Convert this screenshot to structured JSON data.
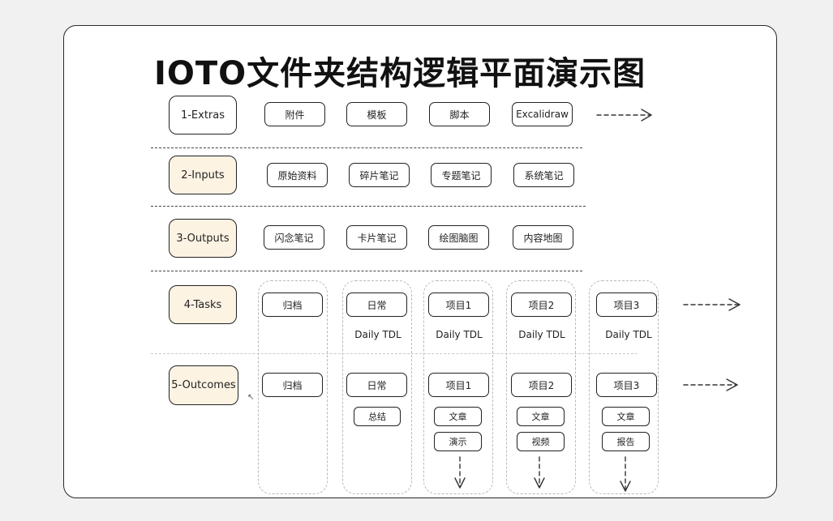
{
  "title": "IOTO文件夹结构逻辑平面演示图",
  "categories": [
    "1-Extras",
    "2-Inputs",
    "3-Outputs",
    "4-Tasks",
    "5-Outcomes"
  ],
  "extras": [
    "附件",
    "模板",
    "脚本",
    "Excalidraw"
  ],
  "inputs": [
    "原始资料",
    "碎片笔记",
    "专题笔记",
    "系统笔记"
  ],
  "outputs": [
    "闪念笔记",
    "卡片笔记",
    "绘图脑图",
    "内容地图"
  ],
  "tasks": {
    "items": [
      "归档",
      "日常",
      "项目1",
      "项目2",
      "项目3"
    ],
    "daily_tdl": "Daily TDL"
  },
  "outcomes": {
    "items": [
      "归档",
      "日常",
      "项目1",
      "项目2",
      "项目3"
    ],
    "daily_summary": "总结",
    "project1": [
      "文章",
      "演示"
    ],
    "project2": [
      "文章",
      "视频"
    ],
    "project3": [
      "文章",
      "报告"
    ]
  },
  "colors": {
    "highlight_fill": "#fdf3e3",
    "stroke": "#222222",
    "column_dash": "#b9b9b9"
  },
  "icons": [
    "dashed-arrow-right",
    "dashed-arrow-down",
    "cursor-icon"
  ]
}
